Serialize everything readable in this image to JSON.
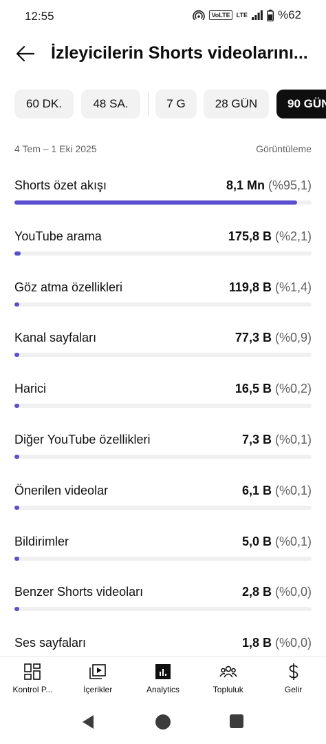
{
  "status_bar": {
    "time": "12:55",
    "volte": "VoLTE",
    "lte": "LTE",
    "battery": "%62"
  },
  "header": {
    "title": "İzleyicilerin Shorts videolarını..."
  },
  "time_ranges": [
    {
      "label": "60 DK.",
      "selected": false
    },
    {
      "label": "48 SA.",
      "selected": false
    },
    {
      "label": "7 G",
      "selected": false
    },
    {
      "label": "28 GÜN",
      "selected": false
    },
    {
      "label": "90 GÜN",
      "selected": true
    }
  ],
  "date_range": "4 Tem – 1 Eki 2025",
  "metric": "Görüntüleme",
  "accent_color": "#5a4fcf",
  "sources": [
    {
      "name": "Shorts özet akışı",
      "value": "8,1 Mn",
      "pct": "(%95,1)",
      "share": 0.951
    },
    {
      "name": "YouTube arama",
      "value": "175,8 B",
      "pct": "(%2,1)",
      "share": 0.021
    },
    {
      "name": "Göz atma özellikleri",
      "value": "119,8 B",
      "pct": "(%1,4)",
      "share": 0.014
    },
    {
      "name": "Kanal sayfaları",
      "value": "77,3 B",
      "pct": "(%0,9)",
      "share": 0.009
    },
    {
      "name": "Harici",
      "value": "16,5 B",
      "pct": "(%0,2)",
      "share": 0.002
    },
    {
      "name": "Diğer YouTube özellikleri",
      "value": "7,3 B",
      "pct": "(%0,1)",
      "share": 0.001
    },
    {
      "name": "Önerilen videolar",
      "value": "6,1 B",
      "pct": "(%0,1)",
      "share": 0.001
    },
    {
      "name": "Bildirimler",
      "value": "5,0 B",
      "pct": "(%0,1)",
      "share": 0.001
    },
    {
      "name": "Benzer Shorts videoları",
      "value": "2,8 B",
      "pct": "(%0,0)",
      "share": 0.0
    },
    {
      "name": "Ses sayfaları",
      "value": "1,8 B",
      "pct": "(%0,0)",
      "share": 0.0
    }
  ],
  "bottom_nav": [
    {
      "label": "Kontrol P...",
      "icon": "dashboard-icon"
    },
    {
      "label": "İçerikler",
      "icon": "content-icon"
    },
    {
      "label": "Analytics",
      "icon": "analytics-icon"
    },
    {
      "label": "Topluluk",
      "icon": "community-icon"
    },
    {
      "label": "Gelir",
      "icon": "earn-icon"
    }
  ]
}
